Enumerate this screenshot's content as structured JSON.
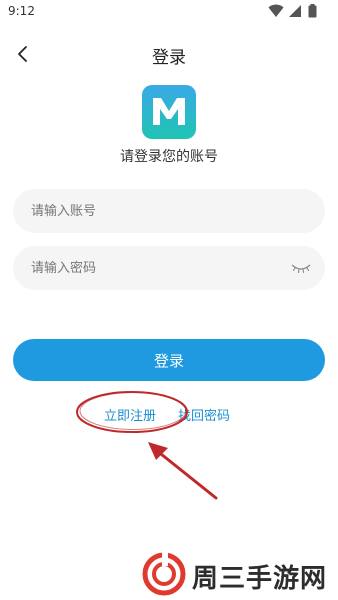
{
  "status_bar": {
    "time": "9:12"
  },
  "nav": {
    "title": "登录"
  },
  "header": {
    "subtitle": "请登录您的账号"
  },
  "form": {
    "account_placeholder": "请输入账号",
    "password_placeholder": "请输入密码",
    "login_label": "登录"
  },
  "links": {
    "register": "立即注册",
    "forgot_password": "找回密码"
  },
  "watermark": {
    "text": "周三手游网"
  },
  "colors": {
    "accent": "#1f9ae0",
    "link": "#1d8fcf",
    "field_bg": "#f5f5f5",
    "annotation": "#c0292b"
  },
  "icons": [
    "back-chevron-icon",
    "app-logo-icon",
    "eye-closed-icon",
    "wifi-icon",
    "signal-icon",
    "battery-icon"
  ]
}
